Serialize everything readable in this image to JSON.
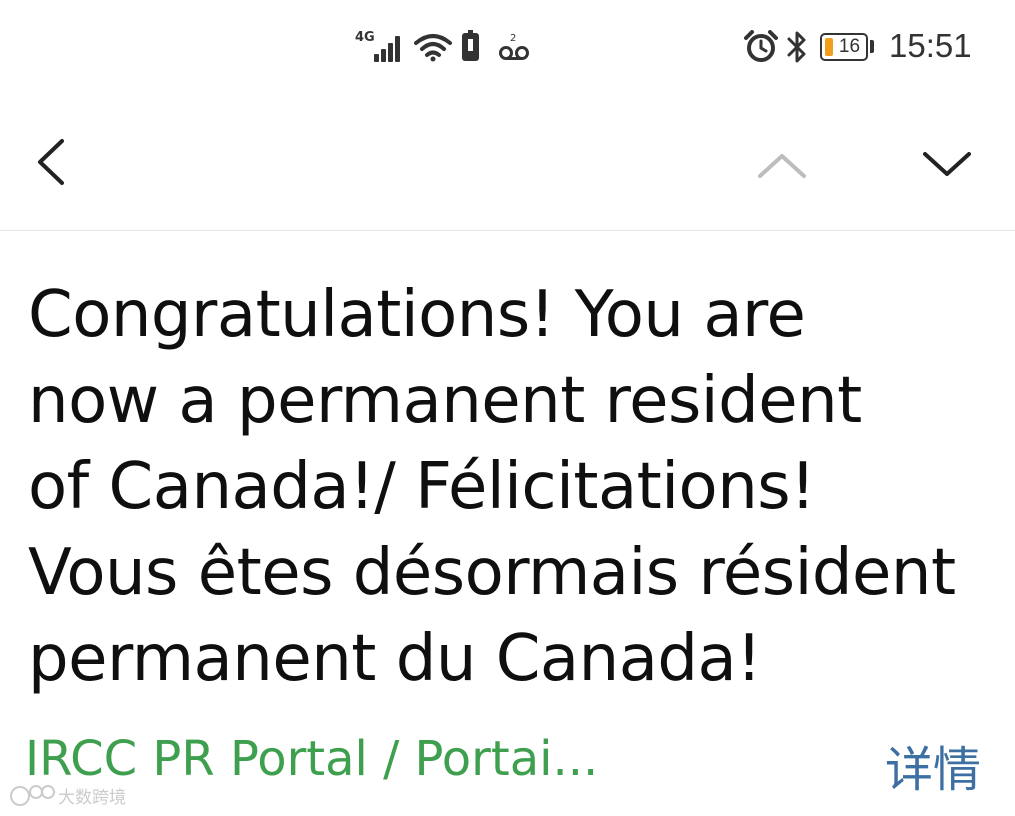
{
  "status_bar": {
    "network_type": "4G",
    "battery_level": "16",
    "time": "15:51",
    "icons": [
      "signal-icon",
      "wifi-icon",
      "battery-alert-icon",
      "voicemail-icon",
      "alarm-icon",
      "bluetooth-icon",
      "battery-icon"
    ],
    "battery_color": "#f29e1d"
  },
  "nav": {
    "icons": [
      "back-chevron-icon",
      "previous-message-up-icon",
      "next-message-down-icon"
    ]
  },
  "message": {
    "lines": [
      "Congratulations! You are",
      "now a permanent resident",
      "of Canada!/ Félicitations!",
      "Vous êtes désormais résident",
      "permanent du Canada!"
    ],
    "sender": "IRCC PR Portal / Portai...",
    "details_label": "详情"
  },
  "watermark": {
    "text": "大数跨境"
  },
  "colors": {
    "sender": "#3ea04e",
    "details_link": "#3d6fa3",
    "text": "#0f0f0f"
  }
}
